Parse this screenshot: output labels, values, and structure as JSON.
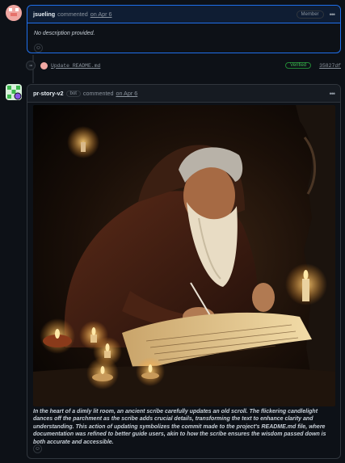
{
  "comment1": {
    "author": "jsueling",
    "action": "commented",
    "date": "on Apr 6",
    "badge": "Member",
    "body": "No description provided."
  },
  "commit": {
    "message": "Update README.md",
    "status": "Verified",
    "sha": "35827df"
  },
  "comment2": {
    "author": "pr-story-v2",
    "bot_label": "bot",
    "action": "commented",
    "date": "on Apr 6",
    "body": "In the heart of a dimly lit room, an ancient scribe carefully updates an old scroll. The flickering candlelight dances off the parchment as the scribe adds crucial details, transforming the text to enhance clarity and understanding. This action of updating symbolizes the commit made to the project's README.md file, where documentation was refined to better guide users, akin to how the scribe ensures the wisdom passed down is both accurate and accessible."
  },
  "colors": {
    "background": "#0d1117",
    "header": "#161b22",
    "border": "#30363d",
    "verified": "#3fb950",
    "highlight_border": "#1f6feb"
  },
  "icons": [
    "avatar-pink-pixel",
    "smiley-icon",
    "kebab-icon",
    "commit-icon",
    "verified-badge",
    "avatar-green-pixel"
  ]
}
